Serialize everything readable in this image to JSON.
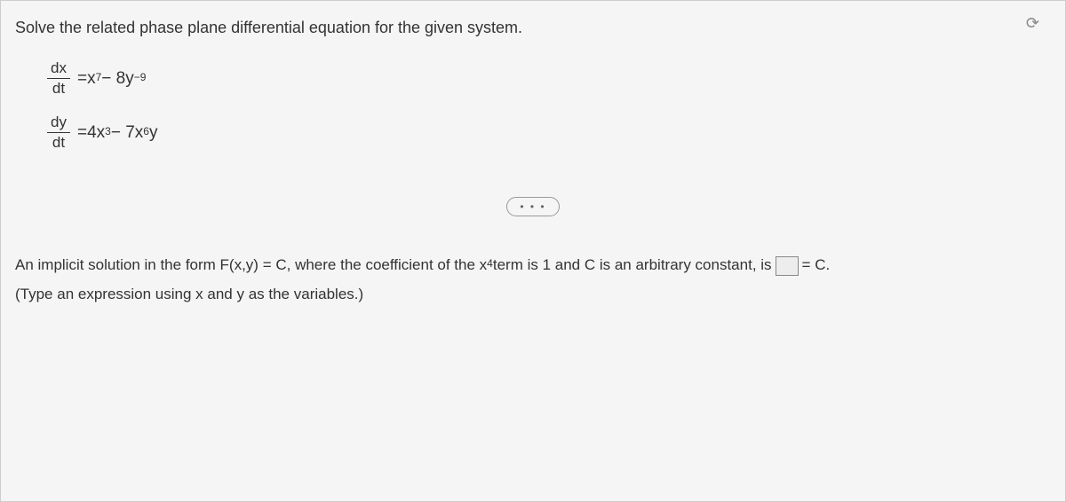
{
  "title": "Solve the related phase plane differential equation for the given system.",
  "equations": {
    "eq1": {
      "frac_num": "dx",
      "frac_den": "dt",
      "equals": " = ",
      "rhs_part1": "x",
      "rhs_exp1": "7",
      "rhs_part2": " − 8y",
      "rhs_exp2": "−9"
    },
    "eq2": {
      "frac_num": "dy",
      "frac_den": "dt",
      "equals": " = ",
      "rhs_part1": "4x",
      "rhs_exp1": "3",
      "rhs_part2": " − 7x",
      "rhs_exp2": "6",
      "rhs_part3": "y"
    }
  },
  "separator": "• • •",
  "prompt": {
    "text1": "An implicit solution in the form F(x,y) = C, where the coefficient of the x",
    "exp": "4",
    "text2": " term is 1 and C is an arbitrary constant, is ",
    "text3": " = C.",
    "hint": "(Type an expression using x and y as the variables.)"
  },
  "reset_icon": "⟳"
}
